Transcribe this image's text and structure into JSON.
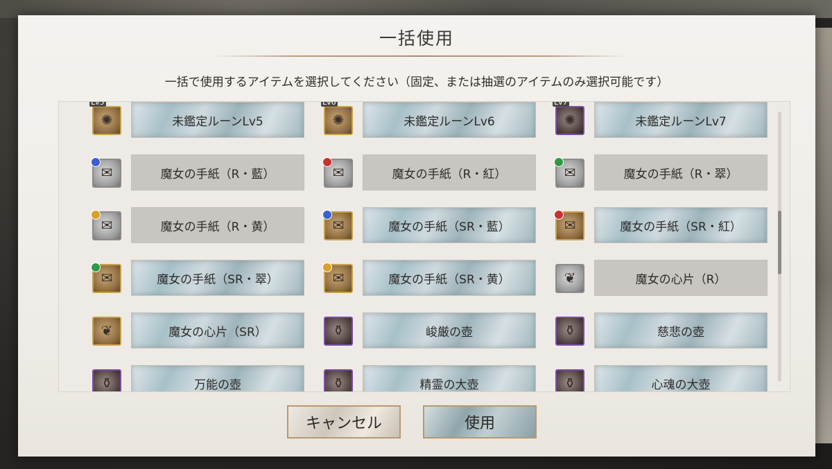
{
  "dialog": {
    "title": "一括使用",
    "instruction": "一括で使用するアイテムを選択してください（固定、または抽選のアイテムのみ選択可能です）"
  },
  "items": [
    {
      "label": "未鑑定ルーンLv5",
      "level": "Lv5",
      "selected": true,
      "frame": "gold",
      "icon": "rune-icon"
    },
    {
      "label": "未鑑定ルーンLv6",
      "level": "Lv6",
      "selected": true,
      "frame": "gold",
      "icon": "rune-icon"
    },
    {
      "label": "未鑑定ルーンLv7",
      "level": "Lv7",
      "selected": true,
      "frame": "purple",
      "icon": "rune-icon"
    },
    {
      "label": "魔女の手紙（R・藍）",
      "selected": false,
      "frame": "gray",
      "icon": "letter-icon",
      "badge": "#3b5fd0"
    },
    {
      "label": "魔女の手紙（R・紅）",
      "selected": false,
      "frame": "gray",
      "icon": "letter-icon",
      "badge": "#c8322e"
    },
    {
      "label": "魔女の手紙（R・翠）",
      "selected": false,
      "frame": "gray",
      "icon": "letter-icon",
      "badge": "#2e9a45"
    },
    {
      "label": "魔女の手紙（R・黄）",
      "selected": false,
      "frame": "gray",
      "icon": "letter-icon",
      "badge": "#d8a12a"
    },
    {
      "label": "魔女の手紙（SR・藍）",
      "selected": true,
      "frame": "gold",
      "icon": "letter-icon",
      "badge": "#3b5fd0"
    },
    {
      "label": "魔女の手紙（SR・紅）",
      "selected": true,
      "frame": "gold",
      "icon": "letter-icon",
      "badge": "#c8322e"
    },
    {
      "label": "魔女の手紙（SR・翠）",
      "selected": true,
      "frame": "gold",
      "icon": "letter-icon",
      "badge": "#2e9a45"
    },
    {
      "label": "魔女の手紙（SR・黄）",
      "selected": true,
      "frame": "gold",
      "icon": "letter-icon",
      "badge": "#d8a12a"
    },
    {
      "label": "魔女の心片（R）",
      "selected": false,
      "frame": "gray",
      "icon": "heart-shard-icon"
    },
    {
      "label": "魔女の心片（SR）",
      "selected": true,
      "frame": "gold",
      "icon": "heart-shard-icon"
    },
    {
      "label": "峻厳の壺",
      "selected": true,
      "frame": "purple",
      "icon": "jar-icon"
    },
    {
      "label": "慈悲の壺",
      "selected": true,
      "frame": "purple",
      "icon": "jar-icon"
    },
    {
      "label": "万能の壺",
      "selected": true,
      "frame": "purple",
      "icon": "jar-icon"
    },
    {
      "label": "精霊の大壺",
      "selected": true,
      "frame": "purple",
      "icon": "jar-icon"
    },
    {
      "label": "心魂の大壺",
      "selected": true,
      "frame": "purple",
      "icon": "jar-icon"
    }
  ],
  "footer": {
    "cancel_label": "キャンセル",
    "use_label": "使用"
  },
  "scroll": {
    "position": 0.48
  }
}
